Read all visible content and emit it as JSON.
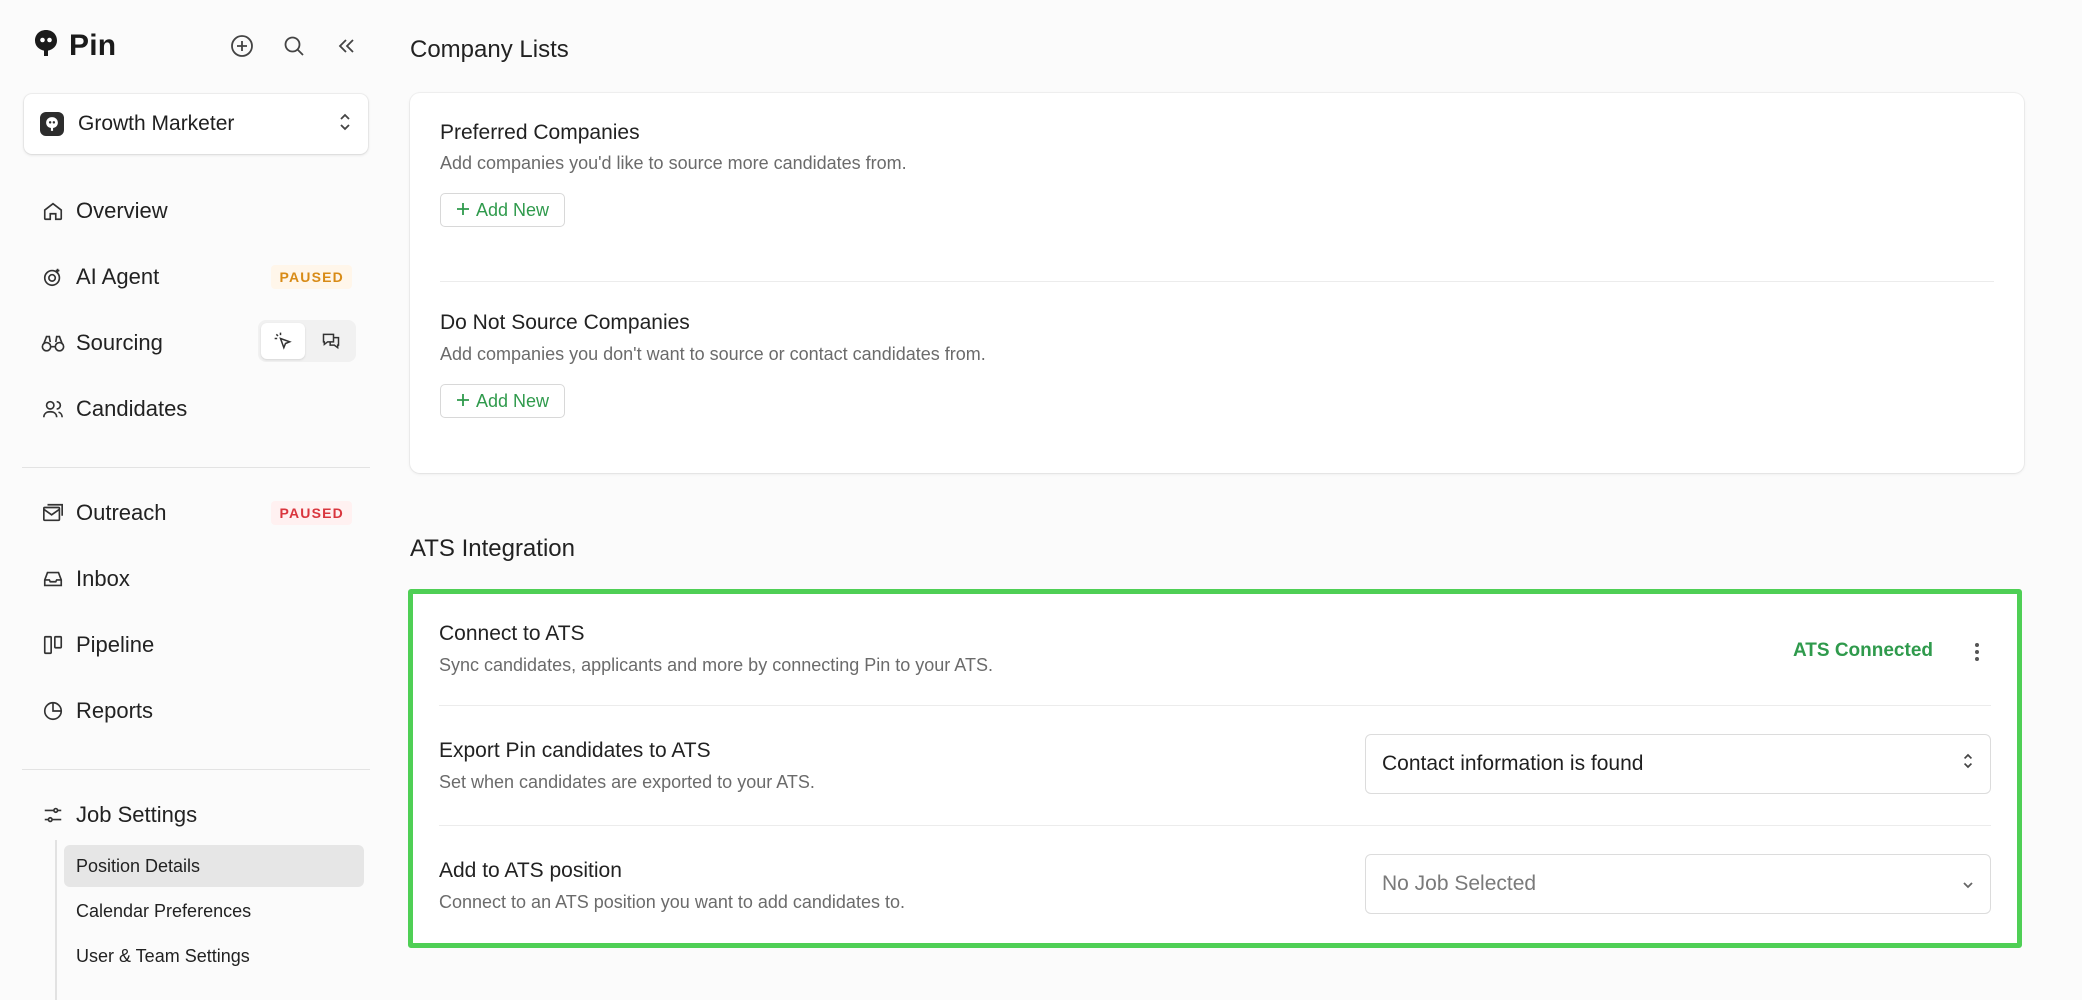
{
  "app": {
    "name": "Pin"
  },
  "job": {
    "name": "Growth Marketer"
  },
  "nav": {
    "overview": "Overview",
    "ai_agent": "AI Agent",
    "ai_agent_badge": "PAUSED",
    "sourcing": "Sourcing",
    "candidates": "Candidates",
    "outreach": "Outreach",
    "outreach_badge": "PAUSED",
    "inbox": "Inbox",
    "pipeline": "Pipeline",
    "reports": "Reports",
    "job_settings": "Job Settings",
    "sub": [
      "Position Details",
      "Calendar Preferences",
      "User & Team Settings"
    ]
  },
  "company_lists": {
    "title": "Company Lists",
    "preferred": {
      "title": "Preferred Companies",
      "desc": "Add companies you'd like to source more candidates from.",
      "button": "Add New"
    },
    "do_not_source": {
      "title": "Do Not Source Companies",
      "desc": "Add companies you don't want to source or contact candidates from.",
      "button": "Add New"
    }
  },
  "ats": {
    "title": "ATS Integration",
    "connect": {
      "title": "Connect to ATS",
      "desc": "Sync candidates, applicants and more by connecting Pin to your ATS.",
      "status": "ATS Connected"
    },
    "export": {
      "title": "Export Pin candidates to ATS",
      "desc": "Set when candidates are exported to your ATS.",
      "value": "Contact information is found"
    },
    "position": {
      "title": "Add to ATS position",
      "desc": "Connect to an ATS position you want to add candidates to.",
      "value": "No Job Selected"
    }
  },
  "colors": {
    "accent_green": "#2f9a4c",
    "highlight_border": "#4fcf55",
    "paused_orange": "#d88b16",
    "paused_red": "#d9363e"
  }
}
